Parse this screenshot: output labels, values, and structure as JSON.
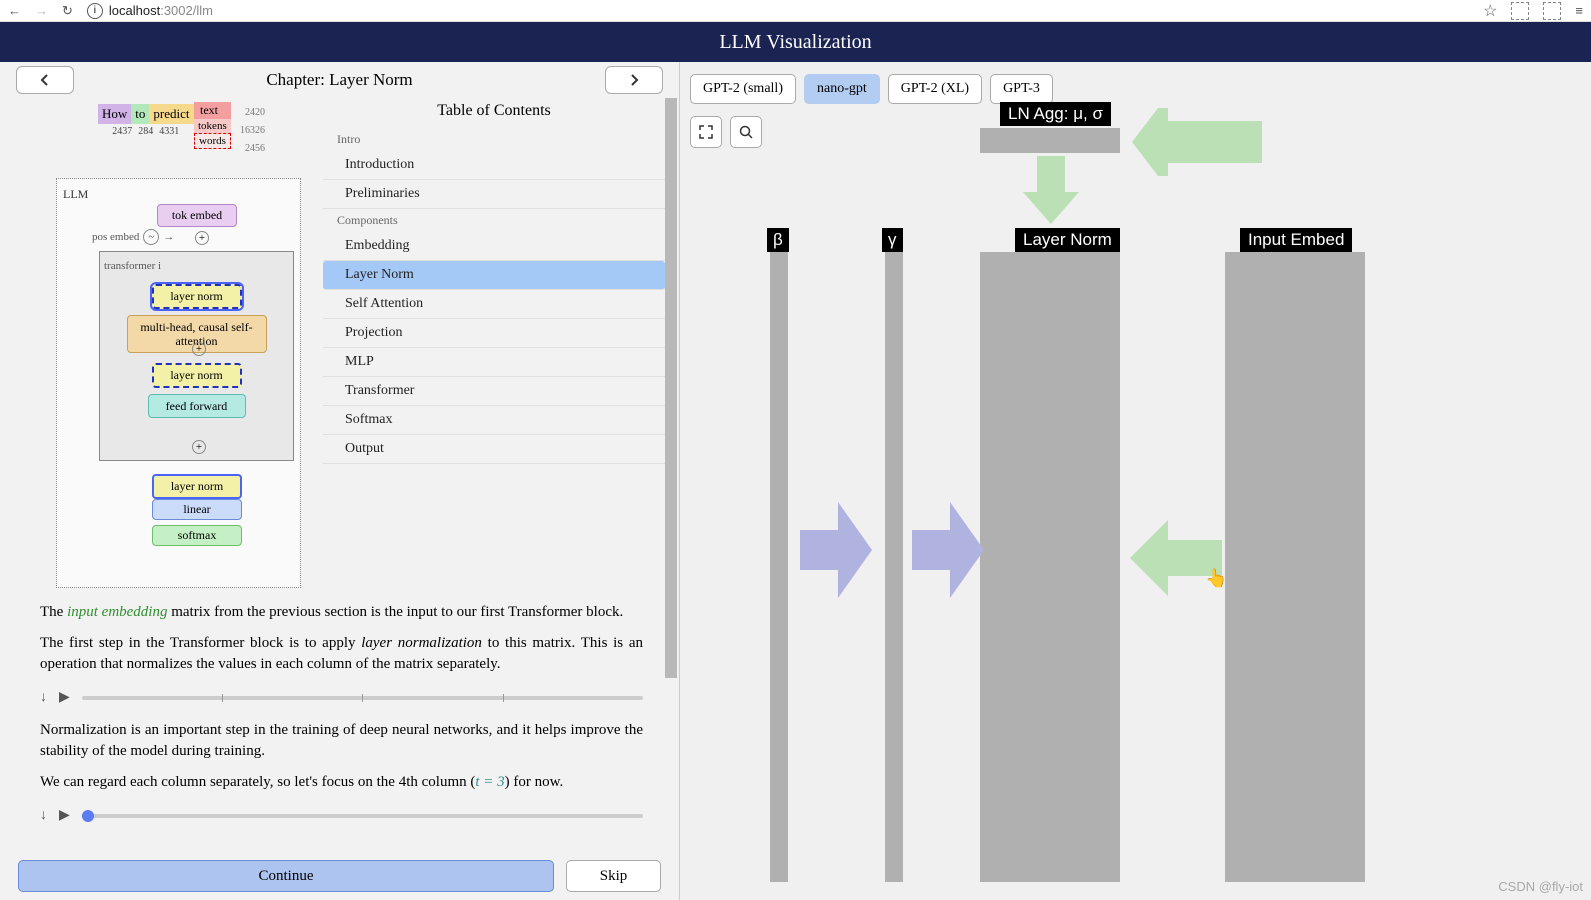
{
  "browser": {
    "url_host": "localhost",
    "url_path": ":3002/llm"
  },
  "header": {
    "title": "LLM Visualization"
  },
  "chapter": {
    "label_prefix": "Chapter:",
    "title": "Layer Norm"
  },
  "tokens": {
    "how": "How",
    "to": "to",
    "predict": "predict",
    "text": "text",
    "tokens": "tokens",
    "words": "words",
    "ids": [
      "2437",
      "284",
      "4331"
    ],
    "side_ids": [
      "2420",
      "16326",
      "2456"
    ]
  },
  "diagram": {
    "llm": "LLM",
    "tokembed": "tok embed",
    "posembed": "pos embed",
    "transformer": "transformer i",
    "layer_norm": "layer norm",
    "mha": "multi-head, causal self-attention",
    "ff": "feed forward",
    "linear": "linear",
    "softmax": "softmax"
  },
  "toc": {
    "title": "Table of Contents",
    "sections": [
      {
        "label": "Intro",
        "items": [
          "Introduction",
          "Preliminaries"
        ]
      },
      {
        "label": "Components",
        "items": [
          "Embedding",
          "Layer Norm",
          "Self Attention",
          "Projection",
          "MLP",
          "Transformer",
          "Softmax",
          "Output"
        ]
      }
    ],
    "active": "Layer Norm"
  },
  "text": {
    "p1a": "The ",
    "p1b": "input embedding",
    "p1c": " matrix from the previous section is the input to our first Transformer block.",
    "p2a": "The first step in the Transformer block is to apply ",
    "p2b": "layer normalization",
    "p2c": " to this matrix. This is an operation that normalizes the values in each column of the matrix separately.",
    "p3": "Normalization is an important step in the training of deep neural networks, and it helps improve the stability of the model during training.",
    "p4a": "We can regard each column separately, so let's focus on the 4th column (",
    "p4b": "t = 3",
    "p4c": ") for now."
  },
  "buttons": {
    "continue": "Continue",
    "skip": "Skip"
  },
  "models": [
    "GPT-2 (small)",
    "nano-gpt",
    "GPT-2 (XL)",
    "GPT-3"
  ],
  "models_active": "nano-gpt",
  "viz": {
    "agg": "LN Agg: μ, σ",
    "beta": "β",
    "gamma": "γ",
    "ln": "Layer Norm",
    "ie": "Input Embed"
  },
  "watermark": "CSDN @fly-iot"
}
